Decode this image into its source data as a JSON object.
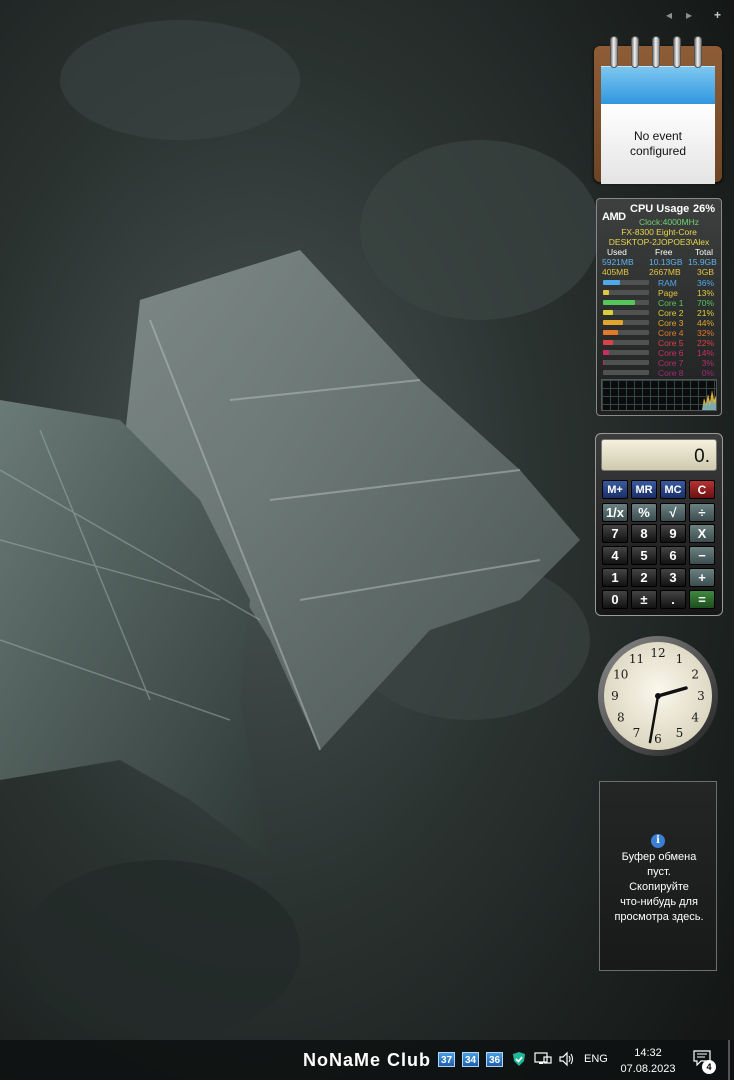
{
  "sidebar": {
    "prev_icon": "◂",
    "next_icon": "▸",
    "add_icon": "+"
  },
  "calendar": {
    "message_line1": "No event",
    "message_line2": "configured"
  },
  "cpu": {
    "brand": "AMD",
    "title": "CPU Usage",
    "usage": "26%",
    "clock": "Clock:4000MHz",
    "model": "FX-8300 Eight-Core",
    "host": "DESKTOP-2JOPOE3\\Alex",
    "headers": [
      "Used",
      "Free",
      "Total"
    ],
    "row_ram": [
      "5921MB",
      "10.13GB",
      "15.9GB"
    ],
    "row_page": [
      "405MB",
      "2667MB",
      "3GB"
    ],
    "bars": [
      {
        "label": "RAM",
        "value": "36%",
        "pct": 36,
        "color": "#4fa9e8"
      },
      {
        "label": "Page",
        "value": "13%",
        "pct": 13,
        "color": "#e3c640"
      },
      {
        "label": "Core 1",
        "value": "70%",
        "pct": 70,
        "color": "#55c65a"
      },
      {
        "label": "Core 2",
        "value": "21%",
        "pct": 21,
        "color": "#d8cf3b"
      },
      {
        "label": "Core 3",
        "value": "44%",
        "pct": 44,
        "color": "#e0a52e"
      },
      {
        "label": "Core 4",
        "value": "32%",
        "pct": 32,
        "color": "#e27a2a"
      },
      {
        "label": "Core 5",
        "value": "22%",
        "pct": 22,
        "color": "#d8434a"
      },
      {
        "label": "Core 6",
        "value": "14%",
        "pct": 14,
        "color": "#c63161"
      },
      {
        "label": "Core 7",
        "value": "3%",
        "pct": 3,
        "color": "#b0306e"
      },
      {
        "label": "Core 8",
        "value": "0%",
        "pct": 0,
        "color": "#9a2c74"
      }
    ]
  },
  "calculator": {
    "display": "0.",
    "rows": [
      [
        {
          "label": "M+",
          "kind": "mem"
        },
        {
          "label": "MR",
          "kind": "mem"
        },
        {
          "label": "MC",
          "kind": "mem"
        },
        {
          "label": "C",
          "kind": "clr"
        }
      ],
      [
        {
          "label": "1/x",
          "kind": "op"
        },
        {
          "label": "%",
          "kind": "op"
        },
        {
          "label": "√",
          "kind": "op"
        },
        {
          "label": "÷",
          "kind": "op"
        }
      ],
      [
        {
          "label": "7",
          "kind": "num"
        },
        {
          "label": "8",
          "kind": "num"
        },
        {
          "label": "9",
          "kind": "num"
        },
        {
          "label": "X",
          "kind": "op"
        }
      ],
      [
        {
          "label": "4",
          "kind": "num"
        },
        {
          "label": "5",
          "kind": "num"
        },
        {
          "label": "6",
          "kind": "num"
        },
        {
          "label": "−",
          "kind": "op"
        }
      ],
      [
        {
          "label": "1",
          "kind": "num"
        },
        {
          "label": "2",
          "kind": "num"
        },
        {
          "label": "3",
          "kind": "num"
        },
        {
          "label": "+",
          "kind": "op"
        }
      ],
      [
        {
          "label": "0",
          "kind": "num"
        },
        {
          "label": "±",
          "kind": "num"
        },
        {
          "label": ".",
          "kind": "num"
        },
        {
          "label": "=",
          "kind": "eq"
        }
      ]
    ]
  },
  "clock": {
    "numbers": [
      "12",
      "1",
      "2",
      "3",
      "4",
      "5",
      "6",
      "7",
      "8",
      "9",
      "10",
      "11"
    ]
  },
  "clipboard": {
    "info_icon": "i",
    "lines": [
      "Буфер обмена",
      "пуст.",
      "Скопируйте",
      "что-нибудь для",
      "просмотра здесь."
    ]
  },
  "taskbar": {
    "brand": "NoNaMe Club",
    "tray_numbers": [
      "37",
      "34",
      "36"
    ],
    "language": "ENG",
    "time": "14:32",
    "date": "07.08.2023",
    "notifications": "4"
  }
}
